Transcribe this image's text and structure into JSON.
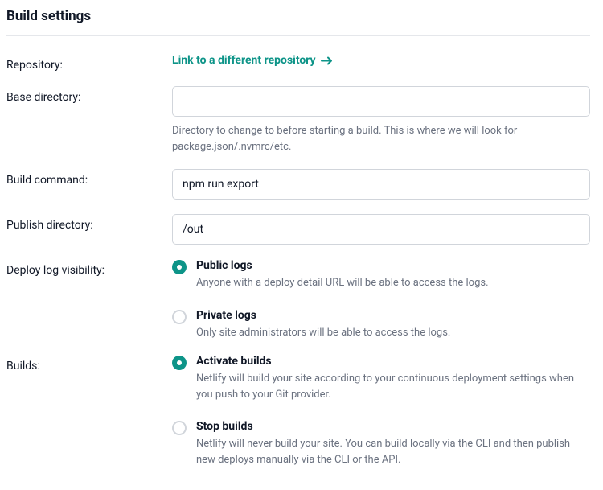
{
  "title": "Build settings",
  "fields": {
    "repository": {
      "label": "Repository:",
      "link_text": "Link to a different repository"
    },
    "base_directory": {
      "label": "Base directory:",
      "value": "",
      "help": "Directory to change to before starting a build. This is where we will look for package.json/.nvmrc/etc."
    },
    "build_command": {
      "label": "Build command:",
      "value": "npm run export"
    },
    "publish_directory": {
      "label": "Publish directory:",
      "value": "/out"
    },
    "deploy_log_visibility": {
      "label": "Deploy log visibility:",
      "options": [
        {
          "title": "Public logs",
          "desc": "Anyone with a deploy detail URL will be able to access the logs.",
          "selected": true
        },
        {
          "title": "Private logs",
          "desc": "Only site administrators will be able to access the logs.",
          "selected": false
        }
      ]
    },
    "builds": {
      "label": "Builds:",
      "options": [
        {
          "title": "Activate builds",
          "desc": "Netlify will build your site according to your continuous deployment settings when you push to your Git provider.",
          "selected": true
        },
        {
          "title": "Stop builds",
          "desc": "Netlify will never build your site. You can build locally via the CLI and then publish new deploys manually via the CLI or the API.",
          "selected": false
        }
      ]
    }
  }
}
